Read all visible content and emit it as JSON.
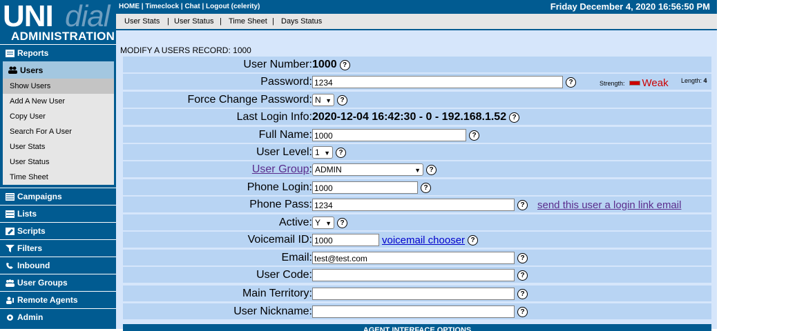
{
  "logo": {
    "uni": "UNI",
    "dial": "dial",
    "admin": "ADMINISTRATION"
  },
  "topbar": {
    "links": "HOME | Timeclock | Chat | Logout (celerity)",
    "datetime": "Friday December 4, 2020 16:56:50 PM"
  },
  "subnav": [
    "User Stats",
    "|",
    "User Status",
    "|",
    "Time Sheet",
    "|",
    "Days Status"
  ],
  "sidebar": {
    "reports": "Reports",
    "users": "Users",
    "users_sub": [
      "Show Users",
      "Add A New User",
      "Copy User",
      "Search For A User",
      "User Stats",
      "User Status",
      "Time Sheet"
    ],
    "campaigns": "Campaigns",
    "lists": "Lists",
    "scripts": "Scripts",
    "filters": "Filters",
    "inbound": "Inbound",
    "user_groups": "User Groups",
    "remote_agents": "Remote Agents",
    "admin": "Admin"
  },
  "form": {
    "heading": "MODIFY A USERS RECORD: 1000",
    "user_number": {
      "label": "User Number:",
      "value": "1000"
    },
    "password": {
      "label": "Password:",
      "value": "1234",
      "strength_label": "Strength:",
      "strength_value": "Weak",
      "length_label": "Length:",
      "length_value": "4"
    },
    "force_change": {
      "label": "Force Change Password:",
      "value": "N"
    },
    "last_login": {
      "label": "Last Login Info:",
      "value": "2020-12-04 16:42:30 - 0 - 192.168.1.52"
    },
    "full_name": {
      "label": "Full Name:",
      "value": "1000"
    },
    "user_level": {
      "label": "User Level:",
      "value": "1"
    },
    "user_group": {
      "label": "User Group",
      "colon": ":",
      "value": "ADMIN"
    },
    "phone_login": {
      "label": "Phone Login:",
      "value": "1000"
    },
    "phone_pass": {
      "label": "Phone Pass:",
      "value": "1234",
      "link": "send this user a login link email"
    },
    "active": {
      "label": "Active:",
      "value": "Y"
    },
    "voicemail": {
      "label": "Voicemail ID:",
      "value": "1000",
      "link": "voicemail chooser"
    },
    "email": {
      "label": "Email:",
      "value": "test@test.com"
    },
    "user_code": {
      "label": "User Code:",
      "value": ""
    },
    "main_territory": {
      "label": "Main Territory:",
      "value": ""
    },
    "user_nickname": {
      "label": "User Nickname:",
      "value": ""
    },
    "agent_interface": "AGENT INTERFACE OPTIONS"
  },
  "colors": {
    "brand": "#015b91",
    "row": "#b8d4f3",
    "panel": "#d6e6fb",
    "weak": "#cc0000"
  }
}
